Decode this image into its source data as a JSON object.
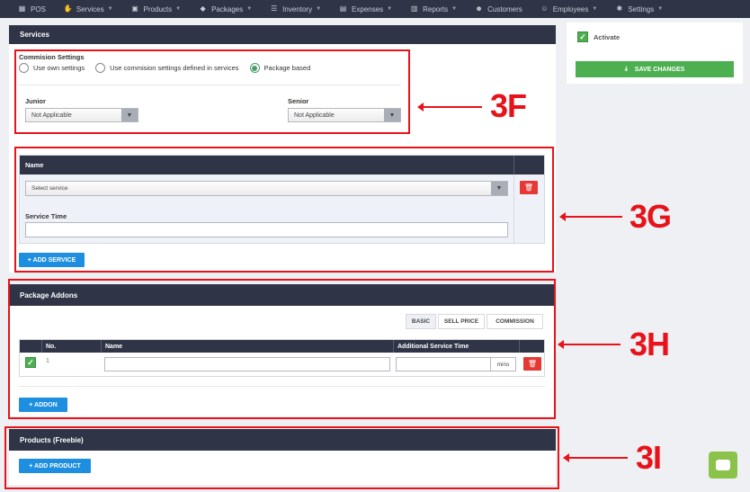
{
  "nav": [
    {
      "label": "POS",
      "icon": "pos-icon",
      "caret": false
    },
    {
      "label": "Services",
      "icon": "services-icon",
      "caret": true
    },
    {
      "label": "Products",
      "icon": "products-icon",
      "caret": true
    },
    {
      "label": "Packages",
      "icon": "packages-icon",
      "caret": true
    },
    {
      "label": "Inventory",
      "icon": "inventory-icon",
      "caret": true
    },
    {
      "label": "Expenses",
      "icon": "expenses-icon",
      "caret": true
    },
    {
      "label": "Reports",
      "icon": "reports-icon",
      "caret": true
    },
    {
      "label": "Customers",
      "icon": "customers-icon",
      "caret": false
    },
    {
      "label": "Employees",
      "icon": "employees-icon",
      "caret": true
    },
    {
      "label": "Settings",
      "icon": "settings-icon",
      "caret": true
    }
  ],
  "services": {
    "header": "Services",
    "commission_title": "Commision Settings",
    "radios": [
      {
        "label": "Use own settings",
        "selected": false
      },
      {
        "label": "Use commision settings defined in services",
        "selected": false
      },
      {
        "label": "Package based",
        "selected": true
      }
    ],
    "junior_label": "Junior",
    "junior_value": "Not Applicable",
    "senior_label": "Senior",
    "senior_value": "Not Applicable"
  },
  "service_table": {
    "col_name": "Name",
    "select_placeholder": "Select service",
    "service_time_label": "Service Time",
    "add_button": "+ ADD SERVICE"
  },
  "addons": {
    "header": "Package Addons",
    "tabs": [
      "BASIC",
      "SELL PRICE",
      "COMMISSION"
    ],
    "active_tab": "BASIC",
    "col_no": "No.",
    "col_name": "Name",
    "col_time": "Additional Service Time",
    "row_no": "1",
    "time_unit": "mins",
    "add_button": "+ ADDON"
  },
  "products": {
    "header": "Products (Freebie)",
    "add_button": "+ ADD PRODUCT"
  },
  "sidebar": {
    "activate_label": "Activate",
    "save_button": "SAVE CHANGES"
  },
  "annotations": {
    "a3f": "3F",
    "a3g": "3G",
    "a3h": "3H",
    "a3i": "3I"
  },
  "colors": {
    "nav_bg": "#2f3446",
    "accent_green": "#4caf50",
    "accent_blue": "#1e8fe0",
    "danger": "#e53935",
    "annotation_red": "#e8121a"
  }
}
